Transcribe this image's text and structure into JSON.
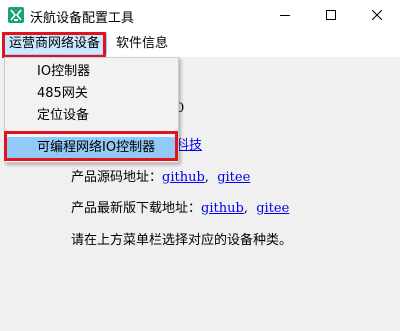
{
  "window": {
    "title": "沃航设备配置工具",
    "icon": "app-logo-icon",
    "controls": [
      "minimize-icon",
      "maximize-icon",
      "close-icon"
    ]
  },
  "menubar": {
    "items": [
      {
        "label": "运营商网络设备"
      },
      {
        "label": "软件信息"
      }
    ]
  },
  "dropdown": {
    "items": [
      {
        "label": "IO控制器"
      },
      {
        "label": "485网关"
      },
      {
        "label": "定位设备"
      },
      {
        "label": "可编程网络IO控制器"
      }
    ]
  },
  "content": {
    "partial_version_tail": "0",
    "partial_company_tail": "科技",
    "source_label": "产品源码地址：",
    "source_links": [
      "github",
      "gitee"
    ],
    "download_label": "产品最新版下载地址：",
    "download_links": [
      "github",
      "gitee"
    ],
    "link_separator": ",",
    "instruction": "请在上方菜单栏选择对应的设备种类。"
  },
  "colors": {
    "highlight_red": "#e0141e",
    "menu_active_bg": "#cce8ff",
    "dropdown_hover_bg": "#91c9f7",
    "link": "#0000ee",
    "app_icon": "#1aa37a"
  }
}
